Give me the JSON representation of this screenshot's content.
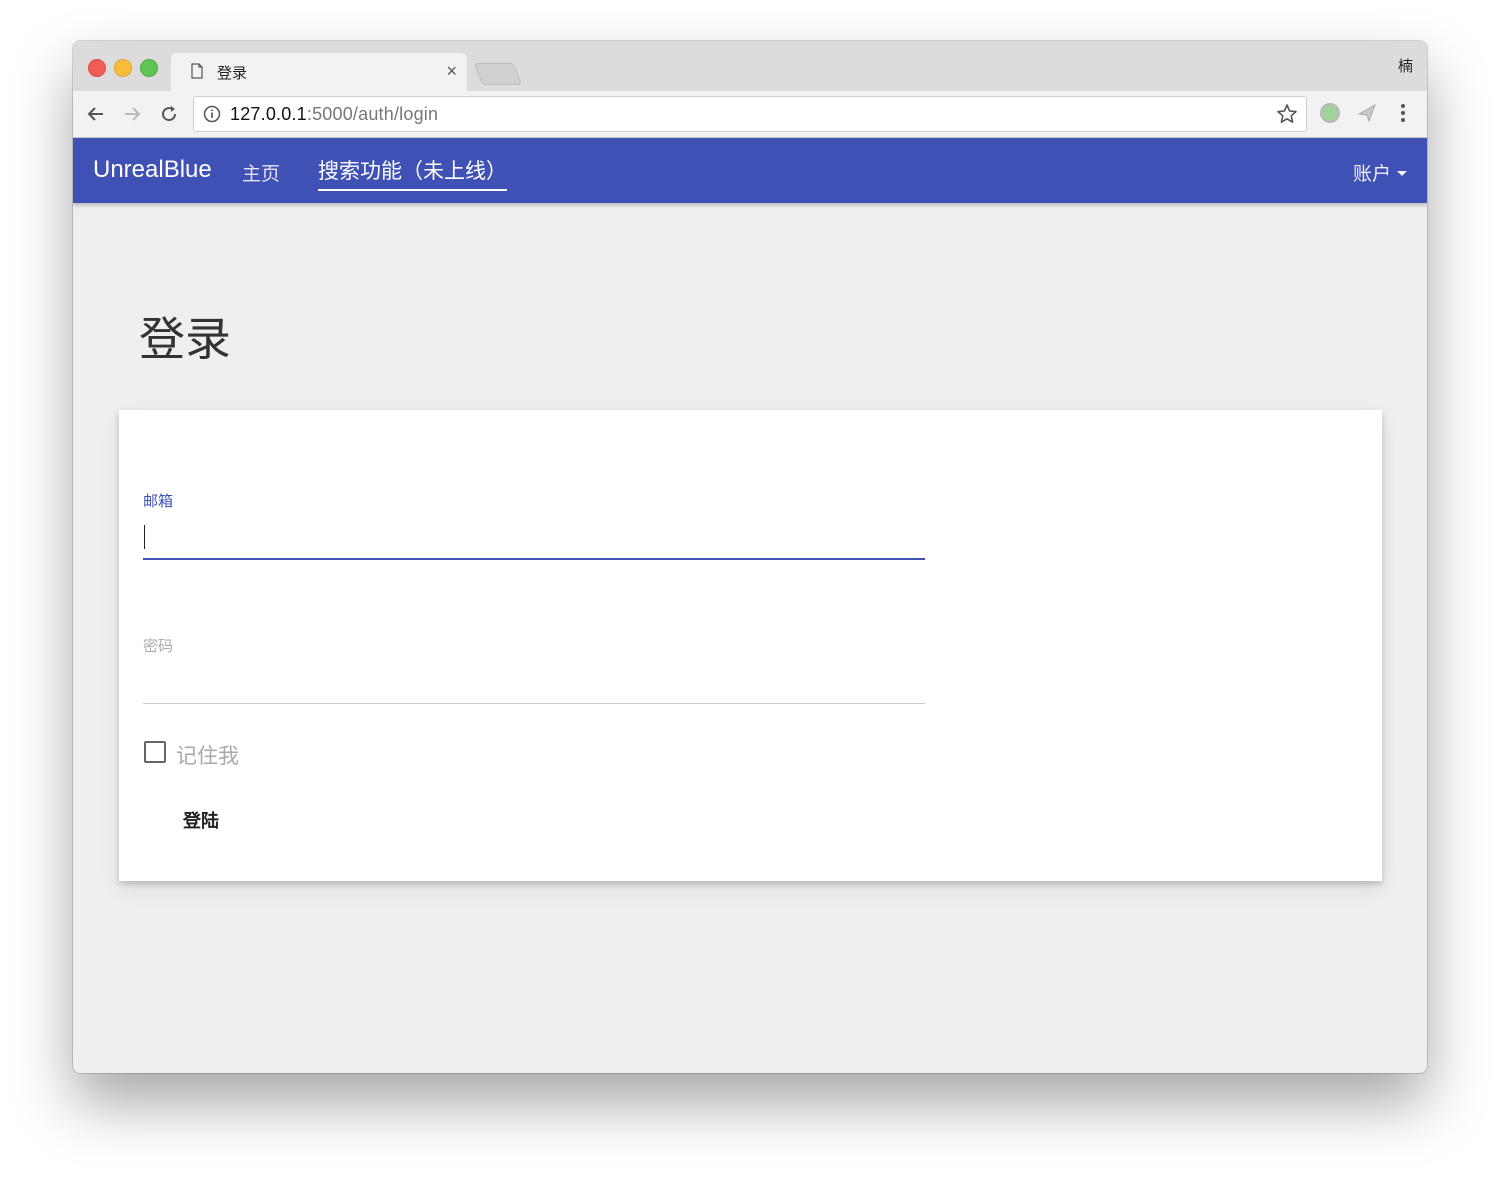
{
  "browser": {
    "tab_title": "登录",
    "tab_close": "×",
    "profile_name": "楠",
    "url_host": "127.0.0.1",
    "url_path": ":5000/auth/login"
  },
  "navbar": {
    "brand": "UnrealBlue",
    "links": [
      {
        "label": "主页"
      },
      {
        "label": "搜索功能（未上线）"
      }
    ],
    "account_label": "账户"
  },
  "page": {
    "title": "登录"
  },
  "form": {
    "email_label": "邮箱",
    "email_value": "",
    "password_label": "密码",
    "password_value": "",
    "remember_label": "记住我",
    "remember_checked": false,
    "submit_label": "登陆"
  },
  "colors": {
    "navbar_bg": "#3f51b5",
    "page_bg": "#efefef",
    "active_field": "#3f51b5",
    "inactive_label": "#aaaaaa"
  }
}
